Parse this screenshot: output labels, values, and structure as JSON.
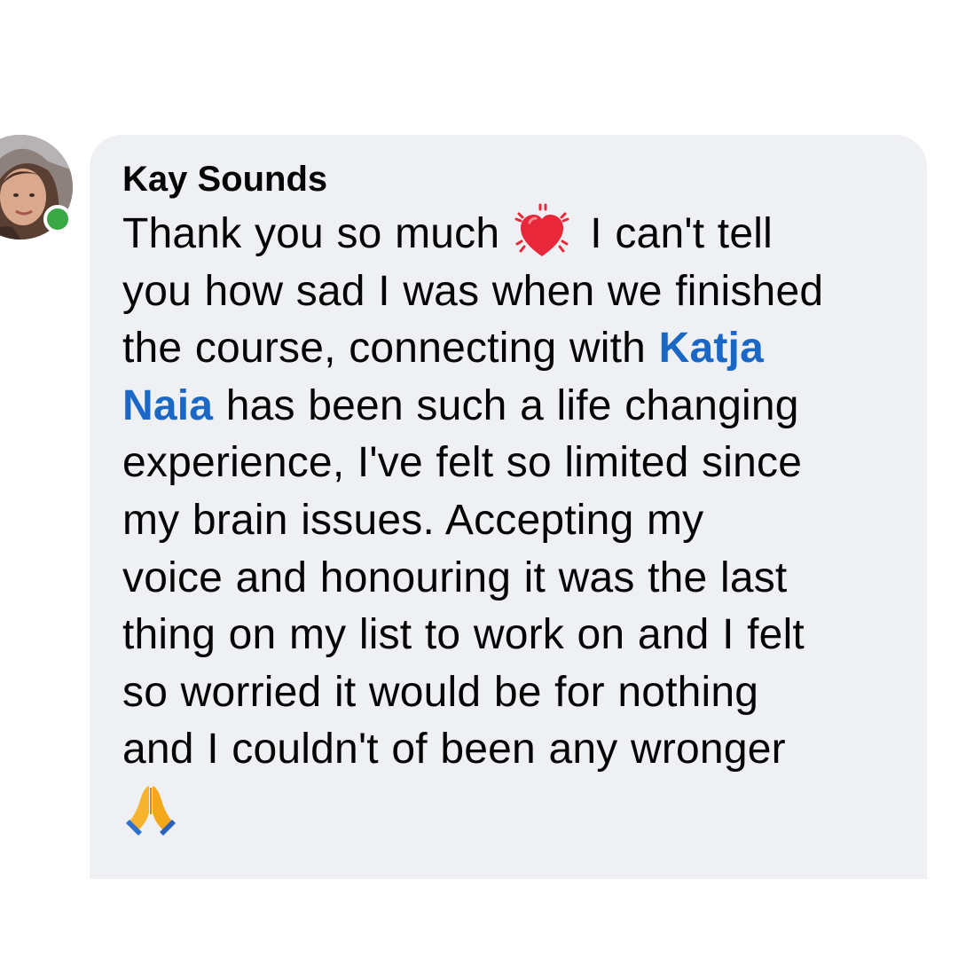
{
  "comment": {
    "author_name": "Kay Sounds",
    "mention_name": "Katja Naia",
    "mention_first": "Katja",
    "mention_last": "Naia",
    "lines": {
      "l1_a": "Thank you so much",
      "l1_b": "I can't tell",
      "l2": "you how sad I was when we finished",
      "l3_a": "the course, connecting with ",
      "l4_b": " has been such a life changing",
      "l5": "experience,  I've felt so limited since",
      "l6": "my brain issues.  Accepting my",
      "l7": "voice and honouring it was the last",
      "l8": "thing on my list to work on and I felt",
      "l9": "so worried it would be for nothing",
      "l10": "and I couldn't of been any wronger"
    },
    "emojis": [
      "beating-heart-emoji",
      "folded-hands-emoji"
    ]
  },
  "avatar": {
    "presence": "online",
    "presence_color": "#39a845"
  },
  "colors": {
    "bubble": "#eff0f4",
    "text": "#050505",
    "mention": "#1a67c5"
  }
}
